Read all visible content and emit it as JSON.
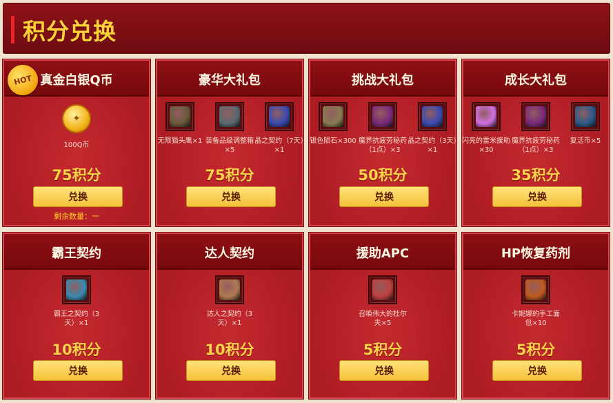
{
  "page": {
    "title": "积分兑换"
  },
  "cards": [
    {
      "title": "真金白银Q币",
      "hot": "HOT",
      "items": [
        {
          "name": "100Q币",
          "icon": "gold-coin-icon",
          "color": "#f4b41a"
        }
      ],
      "points": "75积分",
      "button": "兑换",
      "remain": "剩余数量：一"
    },
    {
      "title": "豪华大礼包",
      "items": [
        {
          "name": "无限猫头鹰×1",
          "icon": "owl-icon",
          "color": "#6a5a3a"
        },
        {
          "name": "装备品级调整箱×5",
          "icon": "chest-icon",
          "color": "#5a6a70"
        },
        {
          "name": "晶之契约（7天）×1",
          "icon": "contract-icon",
          "color": "#3a4ab0"
        }
      ],
      "points": "75积分",
      "button": "兑换"
    },
    {
      "title": "挑战大礼包",
      "items": [
        {
          "name": "银色陨石×300",
          "icon": "meteor-icon",
          "color": "#8a7a50"
        },
        {
          "name": "魔界抗疲劳秘药（1点）×3",
          "icon": "potion-icon",
          "color": "#7a2a7a"
        },
        {
          "name": "晶之契约（3天）×1",
          "icon": "contract-icon",
          "color": "#3a4ab0"
        }
      ],
      "points": "50积分",
      "button": "兑换"
    },
    {
      "title": "成长大礼包",
      "items": [
        {
          "name": "闪亮的雷米援助×30",
          "icon": "sparkle-icon",
          "color": "#d070e0"
        },
        {
          "name": "魔界抗疲劳秘药（1点）×3",
          "icon": "potion-icon",
          "color": "#7a2a7a"
        },
        {
          "name": "复活币×5",
          "icon": "revive-coin-icon",
          "color": "#2a5a8a"
        }
      ],
      "points": "35积分",
      "button": "兑换"
    },
    {
      "title": "霸王契约",
      "items": [
        {
          "name": "霸王之契约（3天）×1",
          "icon": "crown-icon",
          "color": "#3a8ab0"
        }
      ],
      "points": "10积分",
      "button": "兑换"
    },
    {
      "title": "达人契约",
      "items": [
        {
          "name": "达人之契约（3天）×1",
          "icon": "character-icon",
          "color": "#b07a50"
        }
      ],
      "points": "10积分",
      "button": "兑换"
    },
    {
      "title": "援助APC",
      "items": [
        {
          "name": "召唤伟大的杜尔夫×5",
          "icon": "summon-icon",
          "color": "#c04040"
        }
      ],
      "points": "5积分",
      "button": "兑换"
    },
    {
      "title": "HP恢复药剂",
      "items": [
        {
          "name": "卡妮娜的手工面包×10",
          "icon": "bread-icon",
          "color": "#c05a20"
        }
      ],
      "points": "5积分",
      "button": "兑换"
    }
  ]
}
